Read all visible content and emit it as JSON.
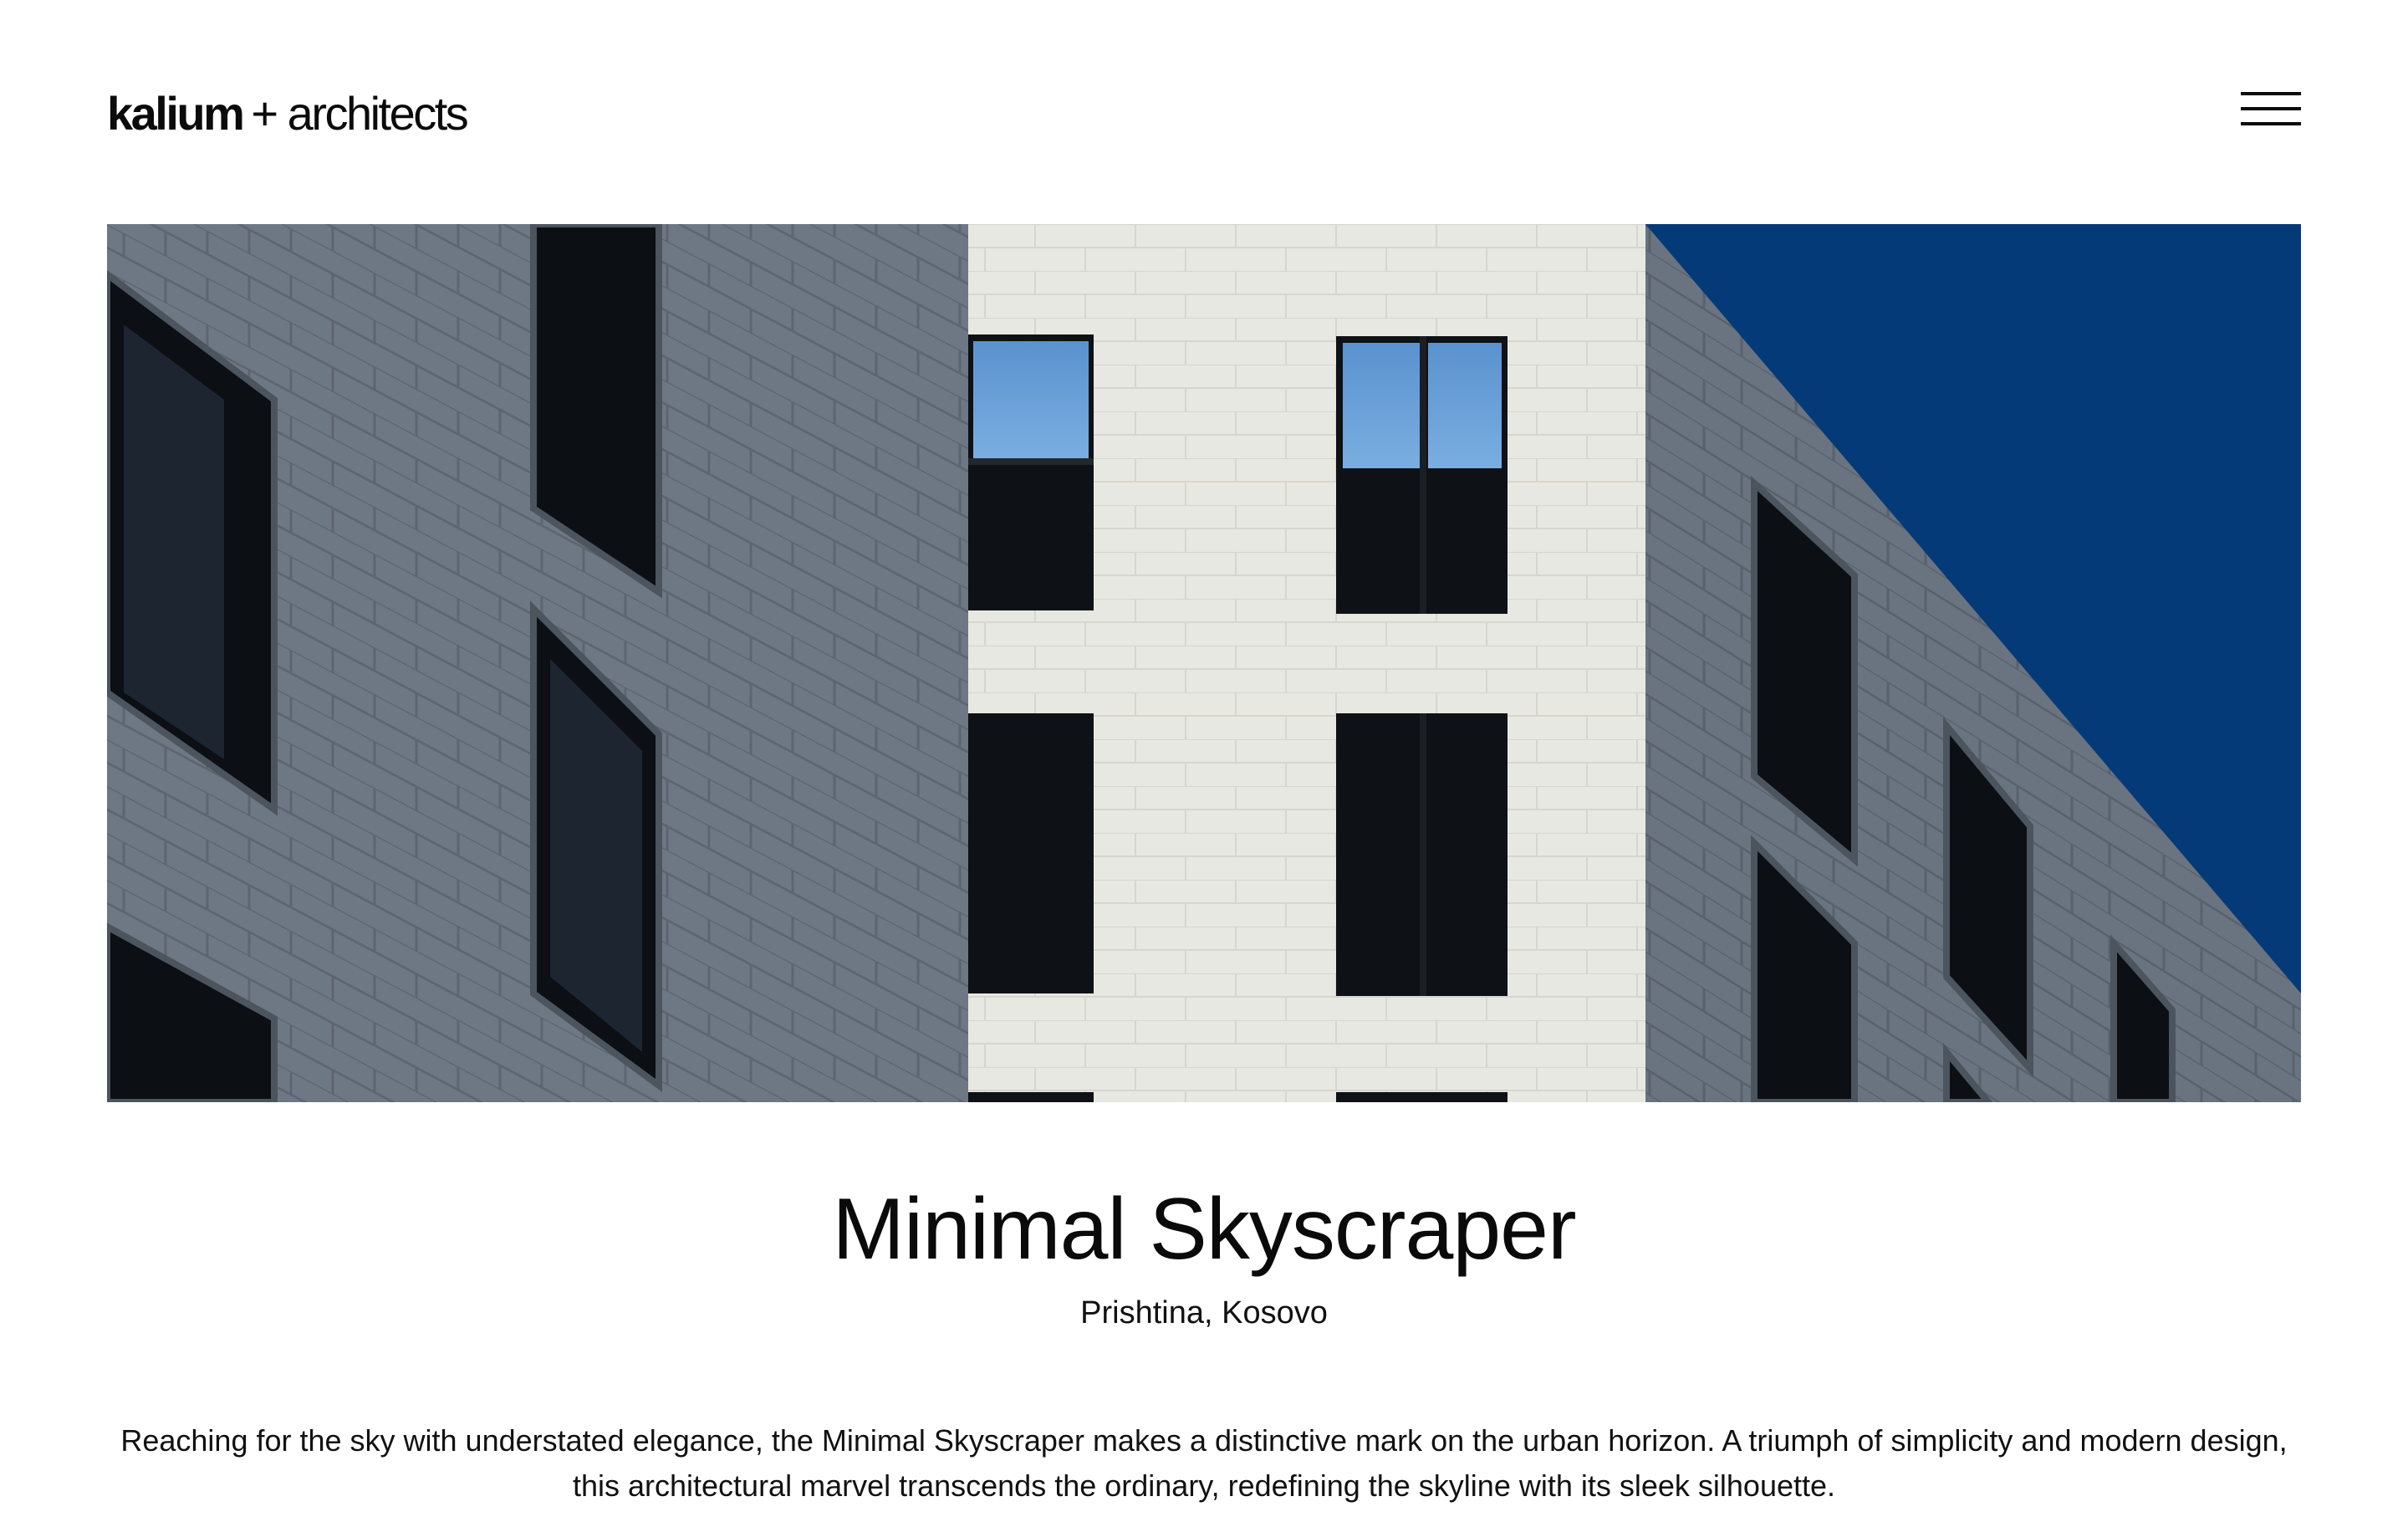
{
  "header": {
    "logo_bold": "kalium",
    "logo_light": "+ architects",
    "menu_icon": "hamburger-menu-icon"
  },
  "hero": {
    "image_subject": "building-facade-photo"
  },
  "project": {
    "title": "Minimal Skyscraper",
    "location": "Prishtina, Kosovo",
    "description": "Reaching for the sky with understated elegance, the Minimal Skyscraper makes a distinctive mark on the urban horizon. A triumph of simplicity and modern design, this architectural marvel transcends the ordinary, redefining the skyline with its sleek silhouette."
  },
  "colors": {
    "text": "#0b0b0b",
    "background": "#ffffff",
    "sky": "#043a78",
    "facade_gray": "#6c7682",
    "facade_white": "#e9e9e3"
  }
}
